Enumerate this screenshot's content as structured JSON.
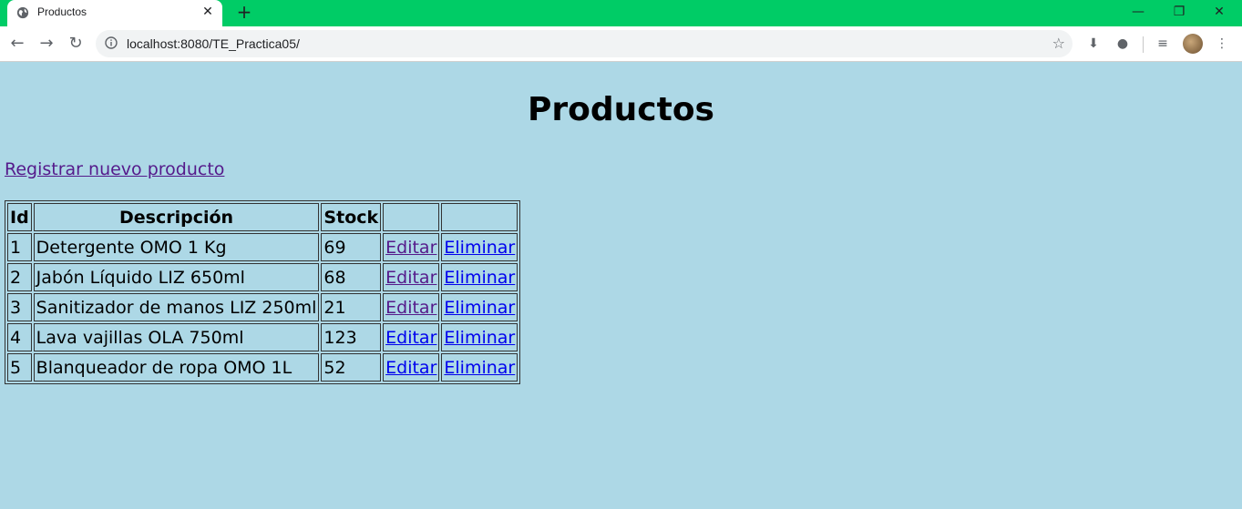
{
  "browser": {
    "tab_title": "Productos",
    "url": "localhost:8080/TE_Practica05/"
  },
  "page": {
    "title": "Productos",
    "new_link": "Registrar nuevo producto",
    "table": {
      "headers": [
        "Id",
        "Descripción",
        "Stock",
        "",
        ""
      ],
      "rows": [
        {
          "id": "1",
          "description": "Detergente OMO 1 Kg",
          "stock": "69",
          "edit": "Editar",
          "delete": "Eliminar"
        },
        {
          "id": "2",
          "description": "Jabón Líquido LIZ 650ml",
          "stock": "68",
          "edit": "Editar",
          "delete": "Eliminar"
        },
        {
          "id": "3",
          "description": "Sanitizador de manos LIZ 250ml",
          "stock": "21",
          "edit": "Editar",
          "delete": "Eliminar"
        },
        {
          "id": "4",
          "description": "Lava vajillas OLA 750ml",
          "stock": "123",
          "edit": "Editar",
          "delete": "Eliminar"
        },
        {
          "id": "5",
          "description": "Blanqueador de ropa OMO 1L",
          "stock": "52",
          "edit": "Editar",
          "delete": "Eliminar"
        }
      ]
    }
  },
  "colors": {
    "tabstrip": "#00cc66",
    "page_background": "#add8e6",
    "link": "#0000ee",
    "visited_link": "#551a8b"
  }
}
